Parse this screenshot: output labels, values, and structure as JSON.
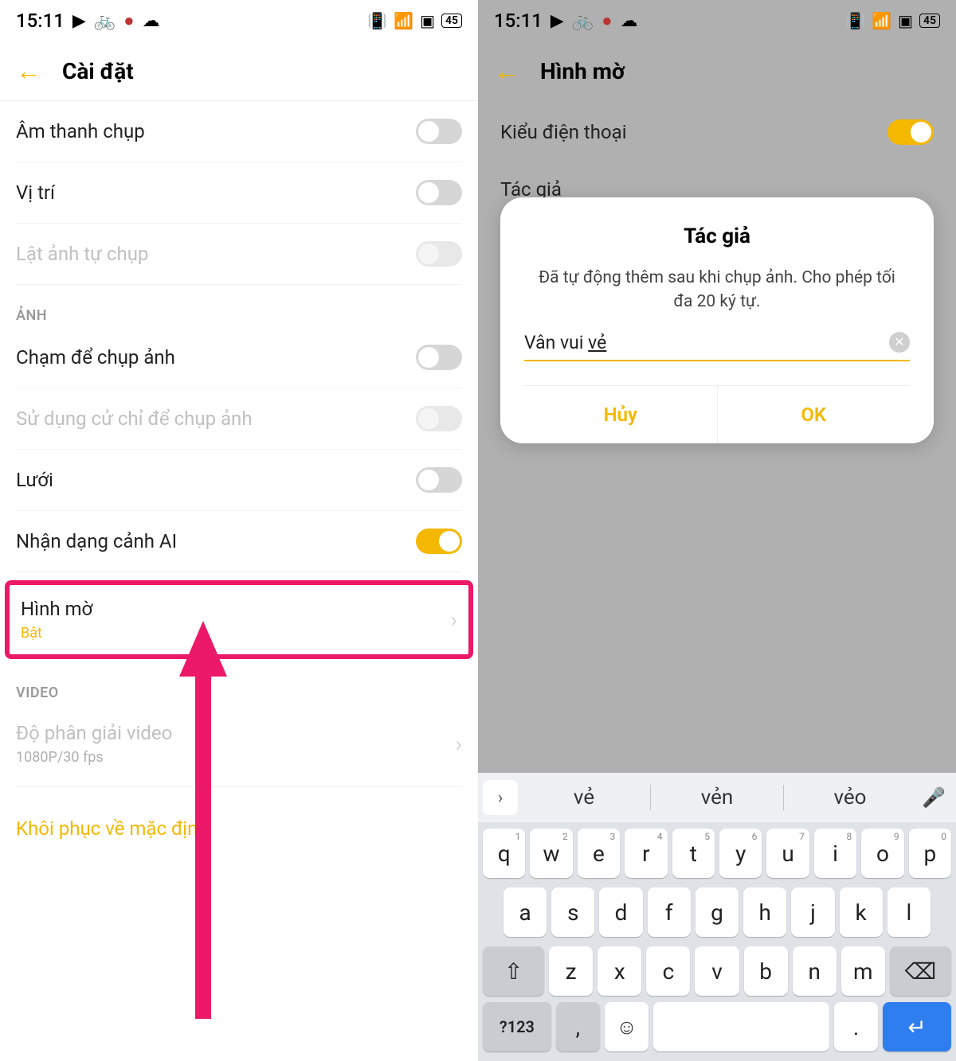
{
  "status": {
    "time": "15:11",
    "battery": "45"
  },
  "left": {
    "title": "Cài đặt",
    "rows": {
      "shutter_sound": "Âm thanh chụp",
      "location": "Vị trí",
      "flip_selfie": "Lật ảnh tự chụp",
      "section_photo": "ẢNH",
      "tap_to_shoot": "Chạm để chụp ảnh",
      "gesture_shoot": "Sử dụng cử chỉ để chụp ảnh",
      "grid": "Lưới",
      "ai_scene": "Nhận dạng cảnh AI",
      "watermark": "Hình mờ",
      "watermark_status": "Bật",
      "section_video": "VIDEO",
      "video_res": "Độ phân giải video",
      "video_res_val": "1080P/30 fps",
      "restore": "Khôi phục về mặc định"
    }
  },
  "right": {
    "title": "Hình mờ",
    "phone_model": "Kiểu điện thoại",
    "author": "Tác giả",
    "dialog": {
      "title": "Tác giả",
      "desc": "Đã tự động thêm sau khi chụp ảnh. Cho phép tối đa 20 ký tự.",
      "value_prefix": "Vân vui ",
      "value_underlined": "vẻ",
      "cancel": "Hủy",
      "ok": "OK"
    }
  },
  "keyboard": {
    "suggestions": [
      "vẻ",
      "vẻn",
      "vẻo"
    ],
    "row1": [
      {
        "k": "q",
        "n": "1"
      },
      {
        "k": "w",
        "n": "2"
      },
      {
        "k": "e",
        "n": "3"
      },
      {
        "k": "r",
        "n": "4"
      },
      {
        "k": "t",
        "n": "5"
      },
      {
        "k": "y",
        "n": "6"
      },
      {
        "k": "u",
        "n": "7"
      },
      {
        "k": "i",
        "n": "8"
      },
      {
        "k": "o",
        "n": "9"
      },
      {
        "k": "p",
        "n": "0"
      }
    ],
    "row2": [
      "a",
      "s",
      "d",
      "f",
      "g",
      "h",
      "j",
      "k",
      "l"
    ],
    "row3": [
      "z",
      "x",
      "c",
      "v",
      "b",
      "n",
      "m"
    ],
    "sym": "?123",
    "comma": ",",
    "dot": "."
  }
}
